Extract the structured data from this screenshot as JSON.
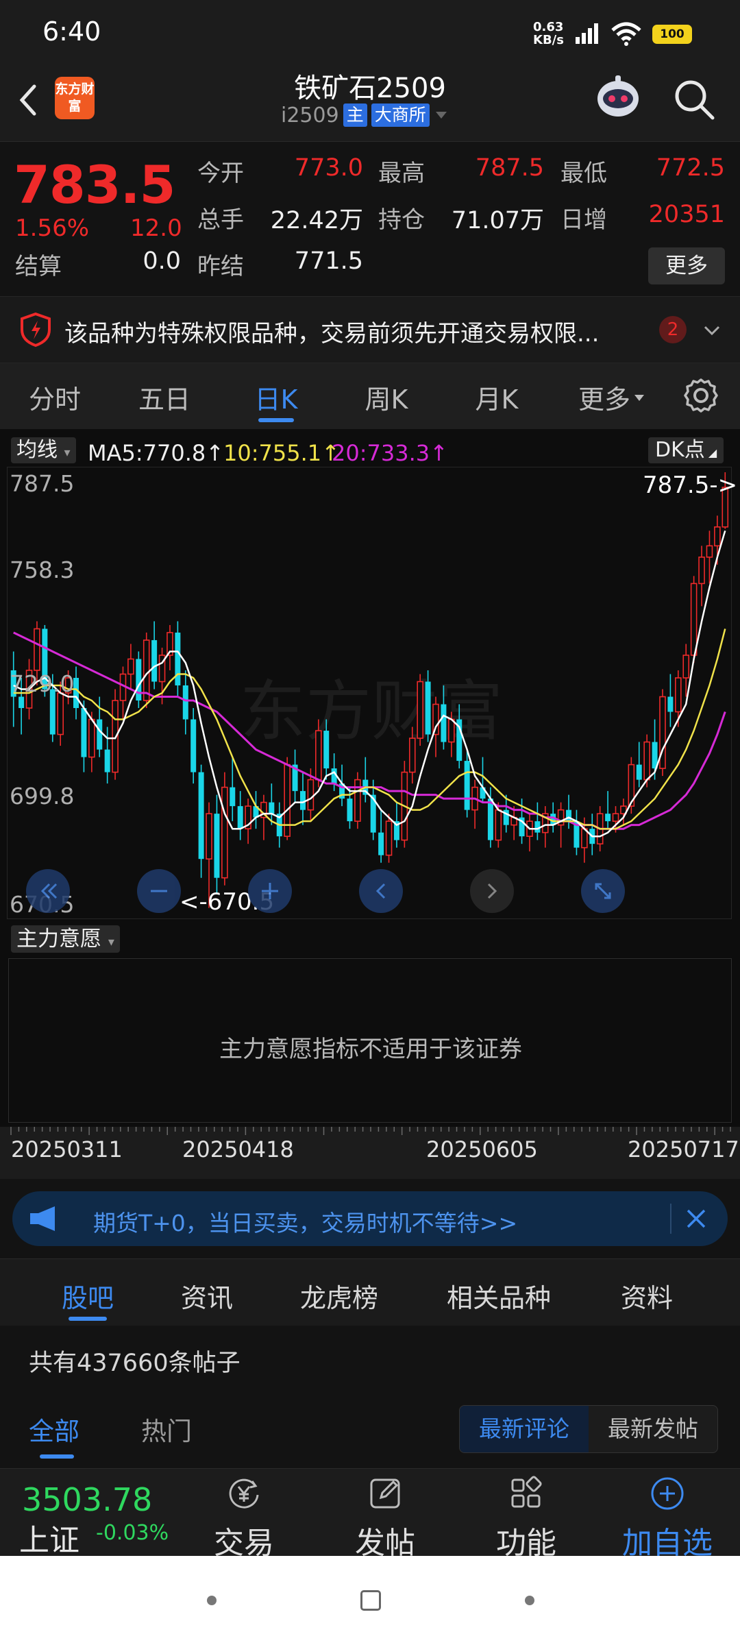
{
  "status_bar": {
    "time": "6:40",
    "net_speed_value": "0.63",
    "net_speed_unit": "KB/s",
    "battery": "100"
  },
  "header": {
    "title": "铁矿石2509",
    "code": "i2509",
    "tags": [
      "主",
      "大商所"
    ],
    "logo_text": "东方财富"
  },
  "quote": {
    "price": "783.5",
    "change_pct": "1.56%",
    "change": "12.0",
    "fields": [
      {
        "label": "今开",
        "value": "773.0",
        "color": "red"
      },
      {
        "label": "最高",
        "value": "787.5",
        "color": "red"
      },
      {
        "label": "最低",
        "value": "772.5",
        "color": "red"
      },
      {
        "label": "总手",
        "value": "22.42万",
        "color": "white"
      },
      {
        "label": "持仓",
        "value": "71.07万",
        "color": "white"
      },
      {
        "label": "日增",
        "value": "20351",
        "color": "red"
      },
      {
        "label": "结算",
        "value": "0.0",
        "color": "white"
      },
      {
        "label": "昨结",
        "value": "771.5",
        "color": "white"
      }
    ],
    "more_label": "更多"
  },
  "notice": {
    "text": "该品种为特殊权限品种，交易前须先开通交易权限...",
    "count": "2"
  },
  "period_tabs": {
    "items": [
      "分时",
      "五日",
      "日K",
      "周K",
      "月K",
      "更多"
    ],
    "active": "日K"
  },
  "chart_header": {
    "ma_select": "均线",
    "ma5": "MA5:770.8↑",
    "ma10": "10:755.1↑",
    "ma20": "20:733.3↑",
    "dk_button": "DK点"
  },
  "chart_data": {
    "type": "candlestick",
    "y_ticks": [
      "787.5",
      "758.3",
      "729.0",
      "699.8",
      "670.5"
    ],
    "ylim": [
      670.5,
      787.5
    ],
    "max_label": "787.5->",
    "min_label": "<-670.5",
    "x_ticks": [
      "20250311",
      "20250418",
      "20250605",
      "20250717"
    ],
    "colors": {
      "up": "#ef2a2a",
      "down": "#1ad6e8",
      "ma5": "#ffffff",
      "ma10": "#f0e24a",
      "ma20": "#d62ad6"
    },
    "ohlc": [
      [
        735,
        740,
        720,
        728
      ],
      [
        728,
        733,
        718,
        725
      ],
      [
        725,
        738,
        722,
        735
      ],
      [
        735,
        748,
        731,
        746
      ],
      [
        746,
        747,
        728,
        730
      ],
      [
        730,
        734,
        716,
        718
      ],
      [
        718,
        732,
        715,
        729
      ],
      [
        729,
        735,
        726,
        733
      ],
      [
        733,
        736,
        722,
        725
      ],
      [
        725,
        727,
        708,
        712
      ],
      [
        712,
        724,
        708,
        722
      ],
      [
        722,
        728,
        712,
        714
      ],
      [
        714,
        720,
        705,
        708
      ],
      [
        708,
        730,
        706,
        727
      ],
      [
        727,
        736,
        722,
        734
      ],
      [
        734,
        742,
        730,
        738
      ],
      [
        738,
        740,
        725,
        727
      ],
      [
        727,
        745,
        725,
        743
      ],
      [
        743,
        748,
        730,
        732
      ],
      [
        732,
        741,
        726,
        739
      ],
      [
        739,
        747,
        735,
        745
      ],
      [
        745,
        748,
        728,
        731
      ],
      [
        731,
        735,
        718,
        722
      ],
      [
        722,
        725,
        705,
        708
      ],
      [
        708,
        710,
        680,
        685
      ],
      [
        685,
        700,
        672,
        697
      ],
      [
        697,
        702,
        676,
        680
      ],
      [
        680,
        708,
        678,
        704
      ],
      [
        704,
        712,
        695,
        699
      ],
      [
        699,
        703,
        690,
        693
      ],
      [
        693,
        701,
        689,
        699
      ],
      [
        699,
        703,
        693,
        696
      ],
      [
        696,
        702,
        690,
        700
      ],
      [
        700,
        705,
        694,
        697
      ],
      [
        697,
        700,
        688,
        691
      ],
      [
        691,
        712,
        690,
        710
      ],
      [
        710,
        714,
        700,
        703
      ],
      [
        703,
        708,
        694,
        698
      ],
      [
        698,
        709,
        695,
        706
      ],
      [
        706,
        722,
        704,
        719
      ],
      [
        719,
        722,
        706,
        709
      ],
      [
        709,
        713,
        703,
        705
      ],
      [
        705,
        710,
        699,
        701
      ],
      [
        701,
        704,
        693,
        695
      ],
      [
        695,
        708,
        693,
        706
      ],
      [
        706,
        712,
        700,
        702
      ],
      [
        702,
        706,
        690,
        692
      ],
      [
        692,
        698,
        684,
        686
      ],
      [
        686,
        697,
        684,
        695
      ],
      [
        695,
        700,
        688,
        690
      ],
      [
        690,
        711,
        688,
        708
      ],
      [
        708,
        720,
        705,
        717
      ],
      [
        717,
        734,
        715,
        732
      ],
      [
        732,
        735,
        716,
        718
      ],
      [
        718,
        728,
        712,
        726
      ],
      [
        726,
        731,
        714,
        716
      ],
      [
        716,
        724,
        712,
        722
      ],
      [
        722,
        726,
        709,
        711
      ],
      [
        711,
        714,
        696,
        698
      ],
      [
        698,
        706,
        693,
        704
      ],
      [
        704,
        712,
        700,
        701
      ],
      [
        701,
        704,
        688,
        690
      ],
      [
        690,
        700,
        688,
        698
      ],
      [
        698,
        702,
        692,
        694
      ],
      [
        694,
        699,
        690,
        696
      ],
      [
        696,
        701,
        689,
        691
      ],
      [
        691,
        697,
        687,
        695
      ],
      [
        695,
        700,
        690,
        692
      ],
      [
        692,
        699,
        688,
        697
      ],
      [
        697,
        700,
        692,
        694
      ],
      [
        694,
        700,
        688,
        698
      ],
      [
        698,
        702,
        693,
        695
      ],
      [
        695,
        698,
        686,
        688
      ],
      [
        688,
        696,
        684,
        693
      ],
      [
        693,
        697,
        686,
        689
      ],
      [
        689,
        699,
        687,
        697
      ],
      [
        697,
        703,
        693,
        695
      ],
      [
        695,
        699,
        692,
        697
      ],
      [
        697,
        701,
        694,
        699
      ],
      [
        699,
        712,
        697,
        710
      ],
      [
        710,
        716,
        704,
        706
      ],
      [
        706,
        718,
        704,
        716
      ],
      [
        716,
        722,
        706,
        709
      ],
      [
        709,
        730,
        707,
        728
      ],
      [
        728,
        734,
        720,
        724
      ],
      [
        724,
        735,
        720,
        733
      ],
      [
        733,
        742,
        728,
        739
      ],
      [
        739,
        760,
        737,
        758
      ],
      [
        758,
        768,
        752,
        765
      ],
      [
        765,
        772,
        758,
        768
      ],
      [
        768,
        776,
        763,
        773
      ],
      [
        773,
        787.5,
        772.5,
        783.5
      ]
    ],
    "ma5": [
      731,
      730,
      730,
      732,
      733,
      731,
      729,
      728,
      728,
      725,
      722,
      719,
      717,
      717,
      721,
      727,
      731,
      734,
      736,
      737,
      740,
      740,
      737,
      731,
      721,
      712,
      704,
      697,
      693,
      693,
      694,
      696,
      697,
      697,
      696,
      698,
      700,
      700,
      701,
      703,
      707,
      708,
      705,
      703,
      703,
      703,
      701,
      698,
      696,
      694,
      695,
      699,
      707,
      714,
      720,
      723,
      722,
      720,
      714,
      707,
      704,
      701,
      698,
      697,
      696,
      695,
      693,
      693,
      694,
      694,
      695,
      696,
      695,
      693,
      691,
      691,
      692,
      694,
      696,
      700,
      703,
      706,
      708,
      714,
      718,
      722,
      726,
      738,
      748,
      757,
      765,
      772
    ],
    "ma10": [
      729,
      729,
      729,
      730,
      731,
      731,
      731,
      730,
      730,
      728,
      727,
      725,
      724,
      722,
      722,
      723,
      724,
      726,
      728,
      729,
      732,
      734,
      734,
      733,
      730,
      726,
      722,
      717,
      712,
      707,
      703,
      699,
      697,
      695,
      694,
      694,
      694,
      695,
      695,
      697,
      699,
      701,
      702,
      702,
      703,
      704,
      704,
      703,
      702,
      700,
      699,
      698,
      698,
      699,
      701,
      703,
      705,
      707,
      708,
      708,
      707,
      705,
      703,
      701,
      700,
      699,
      698,
      697,
      696,
      695,
      695,
      695,
      695,
      694,
      694,
      693,
      693,
      693,
      694,
      695,
      697,
      699,
      701,
      704,
      707,
      710,
      714,
      719,
      725,
      731,
      738,
      746
    ],
    "ma20": [
      745,
      744,
      743,
      742,
      741,
      740,
      739,
      738,
      737,
      736,
      735,
      734,
      733,
      732,
      731,
      730,
      729,
      729,
      728,
      728,
      728,
      728,
      727,
      727,
      726,
      725,
      724,
      722,
      720,
      718,
      716,
      714,
      713,
      712,
      711,
      710,
      709,
      708,
      707,
      706,
      705,
      705,
      704,
      704,
      704,
      704,
      704,
      704,
      703,
      703,
      703,
      702,
      702,
      702,
      702,
      701,
      701,
      701,
      701,
      701,
      700,
      700,
      699,
      699,
      698,
      698,
      697,
      697,
      696,
      696,
      695,
      695,
      694,
      694,
      694,
      693,
      693,
      693,
      693,
      694,
      694,
      695,
      696,
      697,
      698,
      700,
      702,
      705,
      709,
      713,
      718,
      724
    ]
  },
  "chart_controls": [
    "rewind-icon",
    "zoom-out-icon",
    "zoom-in-icon",
    "prev-icon",
    "next-icon",
    "fullscreen-icon"
  ],
  "indicator": {
    "select": "主力意愿",
    "message": "主力意愿指标不适用于该证券"
  },
  "promo": {
    "text": "期货T+0，当日买卖，交易时机不等待>>"
  },
  "section_tabs": {
    "items": [
      "股吧",
      "资讯",
      "龙虎榜",
      "相关品种",
      "资料"
    ],
    "active": "股吧"
  },
  "posts": {
    "count_text": "共有437660条帖子"
  },
  "filter_tabs": {
    "items": [
      "全部",
      "热门"
    ],
    "active": "全部",
    "sort": [
      "最新评论",
      "最新发帖"
    ],
    "sort_active": "最新评论"
  },
  "bottom_bar": {
    "index_value": "3503.78",
    "index_name": "上证",
    "index_pct": "-0.03%",
    "nav": [
      {
        "label": "交易",
        "icon": "trade-icon"
      },
      {
        "label": "发帖",
        "icon": "post-icon"
      },
      {
        "label": "功能",
        "icon": "apps-icon"
      },
      {
        "label": "加自选",
        "icon": "add-watchlist-icon"
      }
    ]
  }
}
